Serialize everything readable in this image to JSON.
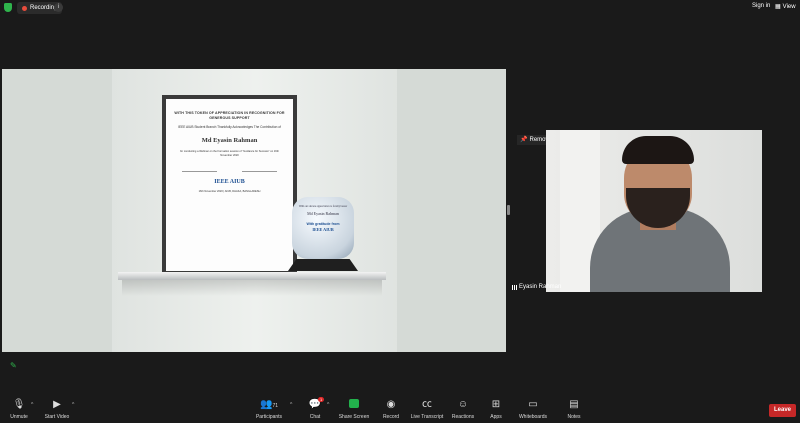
{
  "topbar": {
    "recording_label": "Recording",
    "info_icon": "i",
    "sign_in": "Sign in",
    "view": "View"
  },
  "certificate": {
    "heading": "WITH THIS TOKEN OF APPRECIATION IN RECOGNITION FOR GENEROUS SUPPORT",
    "subheading": "IEEE AIUB Student Branch Thankfully Acknowledges The Contribution of",
    "recipient": "Md Eyasin Rahman",
    "body": "for conducting a Webinar on the Formation session of \"Guidance for Success\" on 16th November 2020",
    "logo": "IEEE AIUB",
    "footer": "16th November 2020 | AIUB, DHAKA, BANGLADESH"
  },
  "trophy": {
    "line1": "With our sincere appreciation to faculty bearer",
    "name": "Md Eyasin Rahman",
    "line3": "With gratitude from",
    "logo": "IEEE AIUB"
  },
  "video": {
    "remove_pin": "Remove Pin",
    "participant_name": "Eyasin Rahman"
  },
  "toolbar": {
    "unmute": "Unmute",
    "start_video": "Start Video",
    "participants": "Participants",
    "participants_count": "71",
    "chat": "Chat",
    "chat_badge": "1",
    "share_screen": "Share Screen",
    "record": "Record",
    "live_transcript": "Live Transcript",
    "reactions": "Reactions",
    "apps": "Apps",
    "whiteboards": "Whiteboards",
    "notes": "Notes",
    "leave": "Leave"
  },
  "colors": {
    "background": "#1a1a1a",
    "share_green": "#22b14c",
    "leave_red": "#c62828",
    "recording_red": "#e74c3c"
  }
}
